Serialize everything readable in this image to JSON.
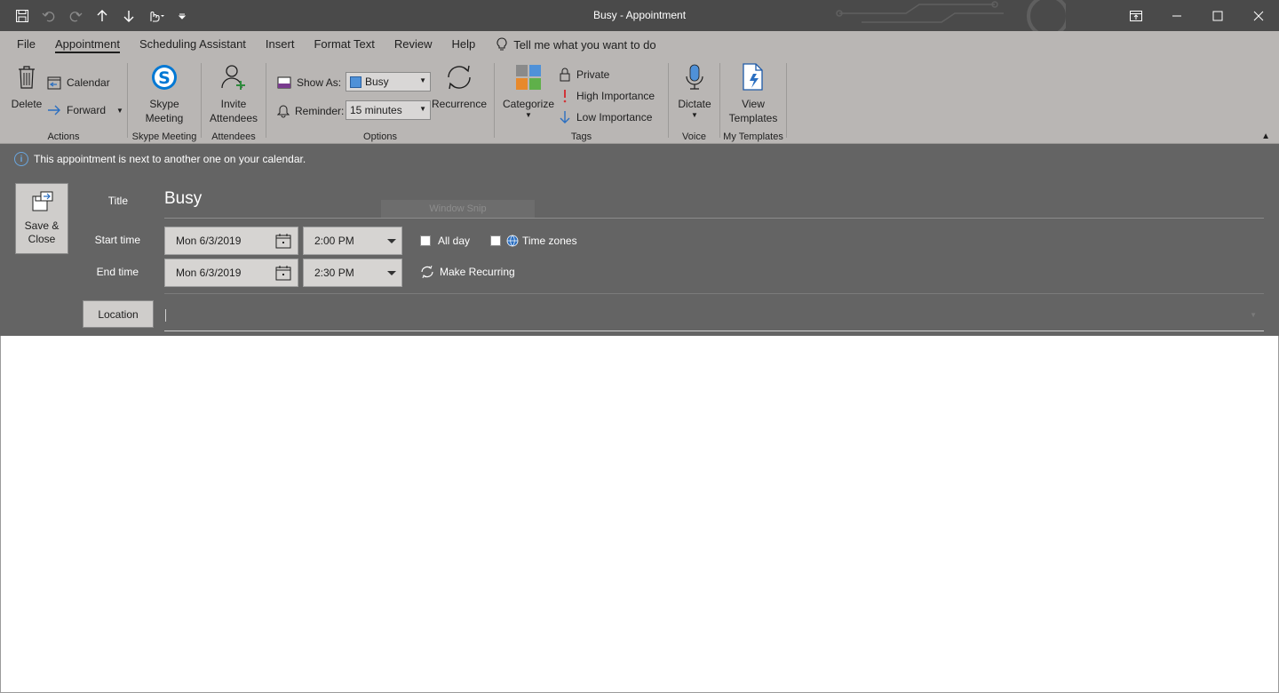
{
  "window": {
    "title": "Busy  -  Appointment"
  },
  "qat": {
    "icons": [
      "save-icon",
      "undo-icon",
      "redo-icon",
      "up-arrow-icon",
      "down-arrow-icon",
      "touch-mode-icon",
      "customize-icon"
    ]
  },
  "tabs": [
    {
      "label": "File"
    },
    {
      "label": "Appointment",
      "active": true
    },
    {
      "label": "Scheduling Assistant"
    },
    {
      "label": "Insert"
    },
    {
      "label": "Format Text"
    },
    {
      "label": "Review"
    },
    {
      "label": "Help"
    }
  ],
  "tellme": {
    "label": "Tell me what you want to do"
  },
  "ribbon": {
    "actions": {
      "label": "Actions",
      "delete": "Delete",
      "calendar": "Calendar",
      "forward": "Forward"
    },
    "skype": {
      "label": "Skype Meeting",
      "button_line1": "Skype",
      "button_line2": "Meeting"
    },
    "attendees": {
      "label": "Attendees",
      "button_line1": "Invite",
      "button_line2": "Attendees"
    },
    "options": {
      "label": "Options",
      "show_as_label": "Show As:",
      "show_as_value": "Busy",
      "reminder_label": "Reminder:",
      "reminder_value": "15 minutes",
      "recurrence": "Recurrence"
    },
    "tags": {
      "label": "Tags",
      "categorize": "Categorize",
      "private": "Private",
      "high": "High Importance",
      "low": "Low Importance"
    },
    "voice": {
      "label": "Voice",
      "dictate": "Dictate"
    },
    "templates": {
      "label": "My Templates",
      "line1": "View",
      "line2": "Templates"
    }
  },
  "info": {
    "text": "This appointment is next to another one on your calendar."
  },
  "form": {
    "save_line1": "Save &",
    "save_line2": "Close",
    "title_label": "Title",
    "title_value": "Busy",
    "start_label": "Start time",
    "start_date": "Mon 6/3/2019",
    "start_time": "2:00 PM",
    "end_label": "End time",
    "end_date": "Mon 6/3/2019",
    "end_time": "2:30 PM",
    "all_day": "All day",
    "time_zones": "Time zones",
    "make_recurring": "Make Recurring",
    "location_label": "Location",
    "location_value": ""
  },
  "overlay": {
    "window_snip": "Window Snip"
  },
  "colors": {
    "titlebar": "#4a4a4a",
    "ribbon": "#b9b6b4",
    "form": "#646464",
    "skype": "#0078d4",
    "accent_blue": "#2b6fc1",
    "importance_red": "#d13438"
  }
}
